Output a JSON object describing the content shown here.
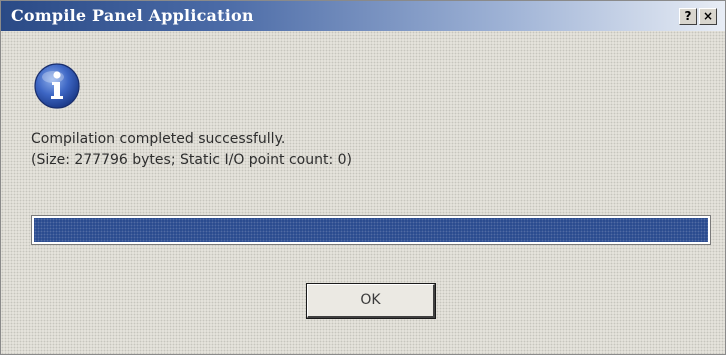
{
  "window": {
    "title": "Compile Panel Application",
    "help_label": "?",
    "close_label": "×"
  },
  "icon": "information-icon",
  "message": {
    "line1": "Compilation completed successfully.",
    "line2": "(Size: 277796 bytes; Static I/O point count: 0)"
  },
  "progress": {
    "percent": 100
  },
  "buttons": {
    "ok_label": "OK"
  },
  "colors": {
    "titlebar_start": "#2a4a86",
    "progress_fill": "#2a4b8f",
    "dialog_background": "#e5e3dc"
  }
}
